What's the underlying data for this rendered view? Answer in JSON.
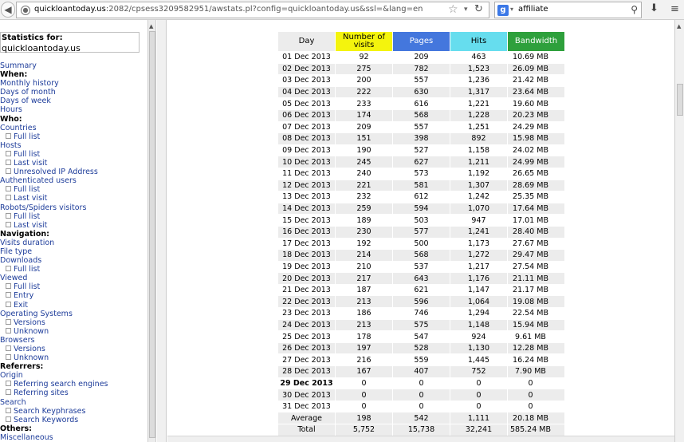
{
  "browser": {
    "url_host": "quickloantoday.us",
    "url_rest": ":2082/cpsess3209582951/awstats.pl?config=quickloantoday.us&ssl=&lang=en",
    "search_engine_letter": "g",
    "search_query": "affiliate"
  },
  "sidebar": {
    "stats_for_label": "Statistics for:",
    "domain": "quickloantoday.us",
    "items": [
      {
        "label": "Summary",
        "type": "link"
      },
      {
        "label": "When:",
        "type": "head"
      },
      {
        "label": "Monthly history",
        "type": "link"
      },
      {
        "label": "Days of month",
        "type": "link"
      },
      {
        "label": "Days of week",
        "type": "link"
      },
      {
        "label": "Hours",
        "type": "link"
      },
      {
        "label": "Who:",
        "type": "head"
      },
      {
        "label": "Countries",
        "type": "link"
      },
      {
        "label": "Full list",
        "type": "sub"
      },
      {
        "label": "Hosts",
        "type": "link"
      },
      {
        "label": "Full list",
        "type": "sub"
      },
      {
        "label": "Last visit",
        "type": "sub"
      },
      {
        "label": "Unresolved IP Address",
        "type": "sub"
      },
      {
        "label": "Authenticated users",
        "type": "link"
      },
      {
        "label": "Full list",
        "type": "sub"
      },
      {
        "label": "Last visit",
        "type": "sub"
      },
      {
        "label": "Robots/Spiders visitors",
        "type": "link"
      },
      {
        "label": "Full list",
        "type": "sub"
      },
      {
        "label": "Last visit",
        "type": "sub"
      },
      {
        "label": "Navigation:",
        "type": "head"
      },
      {
        "label": "Visits duration",
        "type": "link"
      },
      {
        "label": "File type",
        "type": "link"
      },
      {
        "label": "Downloads",
        "type": "link"
      },
      {
        "label": "Full list",
        "type": "sub"
      },
      {
        "label": "Viewed",
        "type": "link"
      },
      {
        "label": "Full list",
        "type": "sub"
      },
      {
        "label": "Entry",
        "type": "sub"
      },
      {
        "label": "Exit",
        "type": "sub"
      },
      {
        "label": "Operating Systems",
        "type": "link"
      },
      {
        "label": "Versions",
        "type": "sub"
      },
      {
        "label": "Unknown",
        "type": "sub"
      },
      {
        "label": "Browsers",
        "type": "link"
      },
      {
        "label": "Versions",
        "type": "sub"
      },
      {
        "label": "Unknown",
        "type": "sub"
      },
      {
        "label": "Referrers:",
        "type": "head"
      },
      {
        "label": "Origin",
        "type": "link"
      },
      {
        "label": "Referring search engines",
        "type": "sub"
      },
      {
        "label": "Referring sites",
        "type": "sub"
      },
      {
        "label": "Search",
        "type": "link"
      },
      {
        "label": "Search Keyphrases",
        "type": "sub"
      },
      {
        "label": "Search Keywords",
        "type": "sub"
      },
      {
        "label": "Others:",
        "type": "head"
      },
      {
        "label": "Miscellaneous",
        "type": "link"
      }
    ]
  },
  "table": {
    "headers": {
      "day": "Day",
      "visits": "Number of visits",
      "pages": "Pages",
      "hits": "Hits",
      "bandwidth": "Bandwidth"
    },
    "header_colors": {
      "visits": "#f4f40d",
      "pages": "#4477dd",
      "hits": "#66ddee",
      "bandwidth": "#2ea03c"
    },
    "rows": [
      [
        "01 Dec 2013",
        "92",
        "209",
        "463",
        "10.69 MB"
      ],
      [
        "02 Dec 2013",
        "275",
        "782",
        "1,523",
        "26.09 MB"
      ],
      [
        "03 Dec 2013",
        "200",
        "557",
        "1,236",
        "21.42 MB"
      ],
      [
        "04 Dec 2013",
        "222",
        "630",
        "1,317",
        "23.64 MB"
      ],
      [
        "05 Dec 2013",
        "233",
        "616",
        "1,221",
        "19.60 MB"
      ],
      [
        "06 Dec 2013",
        "174",
        "568",
        "1,228",
        "20.23 MB"
      ],
      [
        "07 Dec 2013",
        "209",
        "557",
        "1,251",
        "24.29 MB"
      ],
      [
        "08 Dec 2013",
        "151",
        "398",
        "892",
        "15.98 MB"
      ],
      [
        "09 Dec 2013",
        "190",
        "527",
        "1,158",
        "24.02 MB"
      ],
      [
        "10 Dec 2013",
        "245",
        "627",
        "1,211",
        "24.99 MB"
      ],
      [
        "11 Dec 2013",
        "240",
        "573",
        "1,192",
        "26.65 MB"
      ],
      [
        "12 Dec 2013",
        "221",
        "581",
        "1,307",
        "28.69 MB"
      ],
      [
        "13 Dec 2013",
        "232",
        "612",
        "1,242",
        "25.35 MB"
      ],
      [
        "14 Dec 2013",
        "259",
        "594",
        "1,070",
        "17.64 MB"
      ],
      [
        "15 Dec 2013",
        "189",
        "503",
        "947",
        "17.01 MB"
      ],
      [
        "16 Dec 2013",
        "230",
        "577",
        "1,241",
        "28.40 MB"
      ],
      [
        "17 Dec 2013",
        "192",
        "500",
        "1,173",
        "27.67 MB"
      ],
      [
        "18 Dec 2013",
        "214",
        "568",
        "1,272",
        "29.47 MB"
      ],
      [
        "19 Dec 2013",
        "210",
        "537",
        "1,217",
        "27.54 MB"
      ],
      [
        "20 Dec 2013",
        "217",
        "643",
        "1,176",
        "21.11 MB"
      ],
      [
        "21 Dec 2013",
        "187",
        "621",
        "1,147",
        "21.17 MB"
      ],
      [
        "22 Dec 2013",
        "213",
        "596",
        "1,064",
        "19.08 MB"
      ],
      [
        "23 Dec 2013",
        "186",
        "746",
        "1,294",
        "22.54 MB"
      ],
      [
        "24 Dec 2013",
        "213",
        "575",
        "1,148",
        "15.94 MB"
      ],
      [
        "25 Dec 2013",
        "178",
        "547",
        "924",
        "9.61 MB"
      ],
      [
        "26 Dec 2013",
        "197",
        "528",
        "1,130",
        "12.28 MB"
      ],
      [
        "27 Dec 2013",
        "216",
        "559",
        "1,445",
        "16.24 MB"
      ],
      [
        "28 Dec 2013",
        "167",
        "407",
        "752",
        "7.90 MB"
      ],
      [
        "29 Dec 2013",
        "0",
        "0",
        "0",
        "0"
      ],
      [
        "30 Dec 2013",
        "0",
        "0",
        "0",
        "0"
      ],
      [
        "31 Dec 2013",
        "0",
        "0",
        "0",
        "0"
      ]
    ],
    "today_row": 28,
    "average": [
      "Average",
      "198",
      "542",
      "1,111",
      "20.18 MB"
    ],
    "total": [
      "Total",
      "5,752",
      "15,738",
      "32,241",
      "585.24 MB"
    ]
  }
}
